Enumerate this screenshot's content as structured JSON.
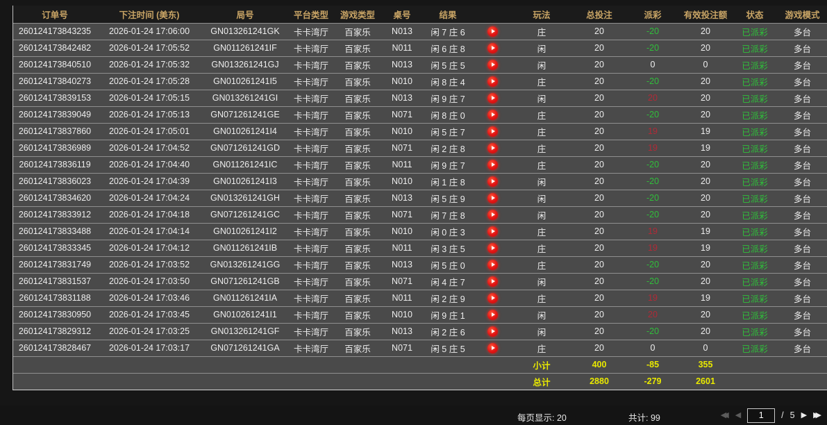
{
  "colors": {
    "green": "#2fbf3a",
    "red": "#b02a37",
    "white": "#f0f0f0",
    "yellow": "#e9e900",
    "gold": "#c8a465"
  },
  "icons": {
    "replay-icon": "red circle with white play triangle",
    "first-page-icon": "◀◀",
    "prev-page-icon": "◀",
    "next-page-icon": "▶",
    "last-page-icon": "▶▶"
  },
  "table": {
    "headers": [
      "订单号",
      "下注时间 (美东)",
      "局号",
      "平台类型",
      "游戏类型",
      "桌号",
      "结果",
      "",
      "玩法",
      "总投注",
      "派彩",
      "有效投注额",
      "状态",
      "游戏模式"
    ],
    "rows": [
      {
        "order_no": "260124173843235",
        "bet_time": "2026-01-24 17:06:00",
        "game_no": "GN013261241GK",
        "platform": "卡卡湾厅",
        "game_type": "百家乐",
        "table_no": "N013",
        "result": "闲 7 庄 6",
        "play": "庄",
        "total_bet": "20",
        "payout": "-20",
        "payout_color": "green",
        "valid_bet": "20",
        "status": "已派彩",
        "mode": "多台"
      },
      {
        "order_no": "260124173842482",
        "bet_time": "2026-01-24 17:05:52",
        "game_no": "GN011261241IF",
        "platform": "卡卡湾厅",
        "game_type": "百家乐",
        "table_no": "N011",
        "result": "闲 6 庄 8",
        "play": "闲",
        "total_bet": "20",
        "payout": "-20",
        "payout_color": "green",
        "valid_bet": "20",
        "status": "已派彩",
        "mode": "多台"
      },
      {
        "order_no": "260124173840510",
        "bet_time": "2026-01-24 17:05:32",
        "game_no": "GN013261241GJ",
        "platform": "卡卡湾厅",
        "game_type": "百家乐",
        "table_no": "N013",
        "result": "闲 5 庄 5",
        "play": "闲",
        "total_bet": "20",
        "payout": "0",
        "payout_color": "white",
        "valid_bet": "0",
        "status": "已派彩",
        "mode": "多台"
      },
      {
        "order_no": "260124173840273",
        "bet_time": "2026-01-24 17:05:28",
        "game_no": "GN010261241I5",
        "platform": "卡卡湾厅",
        "game_type": "百家乐",
        "table_no": "N010",
        "result": "闲 8 庄 4",
        "play": "庄",
        "total_bet": "20",
        "payout": "-20",
        "payout_color": "green",
        "valid_bet": "20",
        "status": "已派彩",
        "mode": "多台"
      },
      {
        "order_no": "260124173839153",
        "bet_time": "2026-01-24 17:05:15",
        "game_no": "GN013261241GI",
        "platform": "卡卡湾厅",
        "game_type": "百家乐",
        "table_no": "N013",
        "result": "闲 9 庄 7",
        "play": "闲",
        "total_bet": "20",
        "payout": "20",
        "payout_color": "red",
        "valid_bet": "20",
        "status": "已派彩",
        "mode": "多台"
      },
      {
        "order_no": "260124173839049",
        "bet_time": "2026-01-24 17:05:13",
        "game_no": "GN071261241GE",
        "platform": "卡卡湾厅",
        "game_type": "百家乐",
        "table_no": "N071",
        "result": "闲 8 庄 0",
        "play": "庄",
        "total_bet": "20",
        "payout": "-20",
        "payout_color": "green",
        "valid_bet": "20",
        "status": "已派彩",
        "mode": "多台"
      },
      {
        "order_no": "260124173837860",
        "bet_time": "2026-01-24 17:05:01",
        "game_no": "GN010261241I4",
        "platform": "卡卡湾厅",
        "game_type": "百家乐",
        "table_no": "N010",
        "result": "闲 5 庄 7",
        "play": "庄",
        "total_bet": "20",
        "payout": "19",
        "payout_color": "red",
        "valid_bet": "19",
        "status": "已派彩",
        "mode": "多台"
      },
      {
        "order_no": "260124173836989",
        "bet_time": "2026-01-24 17:04:52",
        "game_no": "GN071261241GD",
        "platform": "卡卡湾厅",
        "game_type": "百家乐",
        "table_no": "N071",
        "result": "闲 2 庄 8",
        "play": "庄",
        "total_bet": "20",
        "payout": "19",
        "payout_color": "red",
        "valid_bet": "19",
        "status": "已派彩",
        "mode": "多台"
      },
      {
        "order_no": "260124173836119",
        "bet_time": "2026-01-24 17:04:40",
        "game_no": "GN011261241IC",
        "platform": "卡卡湾厅",
        "game_type": "百家乐",
        "table_no": "N011",
        "result": "闲 9 庄 7",
        "play": "庄",
        "total_bet": "20",
        "payout": "-20",
        "payout_color": "green",
        "valid_bet": "20",
        "status": "已派彩",
        "mode": "多台"
      },
      {
        "order_no": "260124173836023",
        "bet_time": "2026-01-24 17:04:39",
        "game_no": "GN010261241I3",
        "platform": "卡卡湾厅",
        "game_type": "百家乐",
        "table_no": "N010",
        "result": "闲 1 庄 8",
        "play": "闲",
        "total_bet": "20",
        "payout": "-20",
        "payout_color": "green",
        "valid_bet": "20",
        "status": "已派彩",
        "mode": "多台"
      },
      {
        "order_no": "260124173834620",
        "bet_time": "2026-01-24 17:04:24",
        "game_no": "GN013261241GH",
        "platform": "卡卡湾厅",
        "game_type": "百家乐",
        "table_no": "N013",
        "result": "闲 5 庄 9",
        "play": "闲",
        "total_bet": "20",
        "payout": "-20",
        "payout_color": "green",
        "valid_bet": "20",
        "status": "已派彩",
        "mode": "多台"
      },
      {
        "order_no": "260124173833912",
        "bet_time": "2026-01-24 17:04:18",
        "game_no": "GN071261241GC",
        "platform": "卡卡湾厅",
        "game_type": "百家乐",
        "table_no": "N071",
        "result": "闲 7 庄 8",
        "play": "闲",
        "total_bet": "20",
        "payout": "-20",
        "payout_color": "green",
        "valid_bet": "20",
        "status": "已派彩",
        "mode": "多台"
      },
      {
        "order_no": "260124173833488",
        "bet_time": "2026-01-24 17:04:14",
        "game_no": "GN010261241I2",
        "platform": "卡卡湾厅",
        "game_type": "百家乐",
        "table_no": "N010",
        "result": "闲 0 庄 3",
        "play": "庄",
        "total_bet": "20",
        "payout": "19",
        "payout_color": "red",
        "valid_bet": "19",
        "status": "已派彩",
        "mode": "多台"
      },
      {
        "order_no": "260124173833345",
        "bet_time": "2026-01-24 17:04:12",
        "game_no": "GN011261241IB",
        "platform": "卡卡湾厅",
        "game_type": "百家乐",
        "table_no": "N011",
        "result": "闲 3 庄 5",
        "play": "庄",
        "total_bet": "20",
        "payout": "19",
        "payout_color": "red",
        "valid_bet": "19",
        "status": "已派彩",
        "mode": "多台"
      },
      {
        "order_no": "260124173831749",
        "bet_time": "2026-01-24 17:03:52",
        "game_no": "GN013261241GG",
        "platform": "卡卡湾厅",
        "game_type": "百家乐",
        "table_no": "N013",
        "result": "闲 5 庄 0",
        "play": "庄",
        "total_bet": "20",
        "payout": "-20",
        "payout_color": "green",
        "valid_bet": "20",
        "status": "已派彩",
        "mode": "多台"
      },
      {
        "order_no": "260124173831537",
        "bet_time": "2026-01-24 17:03:50",
        "game_no": "GN071261241GB",
        "platform": "卡卡湾厅",
        "game_type": "百家乐",
        "table_no": "N071",
        "result": "闲 4 庄 7",
        "play": "闲",
        "total_bet": "20",
        "payout": "-20",
        "payout_color": "green",
        "valid_bet": "20",
        "status": "已派彩",
        "mode": "多台"
      },
      {
        "order_no": "260124173831188",
        "bet_time": "2026-01-24 17:03:46",
        "game_no": "GN011261241IA",
        "platform": "卡卡湾厅",
        "game_type": "百家乐",
        "table_no": "N011",
        "result": "闲 2 庄 9",
        "play": "庄",
        "total_bet": "20",
        "payout": "19",
        "payout_color": "red",
        "valid_bet": "19",
        "status": "已派彩",
        "mode": "多台"
      },
      {
        "order_no": "260124173830950",
        "bet_time": "2026-01-24 17:03:45",
        "game_no": "GN010261241I1",
        "platform": "卡卡湾厅",
        "game_type": "百家乐",
        "table_no": "N010",
        "result": "闲 9 庄 1",
        "play": "闲",
        "total_bet": "20",
        "payout": "20",
        "payout_color": "red",
        "valid_bet": "20",
        "status": "已派彩",
        "mode": "多台"
      },
      {
        "order_no": "260124173829312",
        "bet_time": "2026-01-24 17:03:25",
        "game_no": "GN013261241GF",
        "platform": "卡卡湾厅",
        "game_type": "百家乐",
        "table_no": "N013",
        "result": "闲 2 庄 6",
        "play": "闲",
        "total_bet": "20",
        "payout": "-20",
        "payout_color": "green",
        "valid_bet": "20",
        "status": "已派彩",
        "mode": "多台"
      },
      {
        "order_no": "260124173828467",
        "bet_time": "2026-01-24 17:03:17",
        "game_no": "GN071261241GA",
        "platform": "卡卡湾厅",
        "game_type": "百家乐",
        "table_no": "N071",
        "result": "闲 5 庄 5",
        "play": "庄",
        "total_bet": "20",
        "payout": "0",
        "payout_color": "white",
        "valid_bet": "0",
        "status": "已派彩",
        "mode": "多台"
      }
    ],
    "subtotal": {
      "label": "小计",
      "total_bet": "400",
      "payout": "-85",
      "valid_bet": "355"
    },
    "grand_total": {
      "label": "总计",
      "total_bet": "2880",
      "payout": "-279",
      "valid_bet": "2601"
    }
  },
  "pagination": {
    "per_page_label": "每页显示: 20",
    "total_label": "共计: 99",
    "first_icon": "◀◀",
    "prev_icon": "◀",
    "next_icon": "▶",
    "last_icon": "▶▶",
    "current_page": "1",
    "separator": "/",
    "total_pages": "5"
  }
}
